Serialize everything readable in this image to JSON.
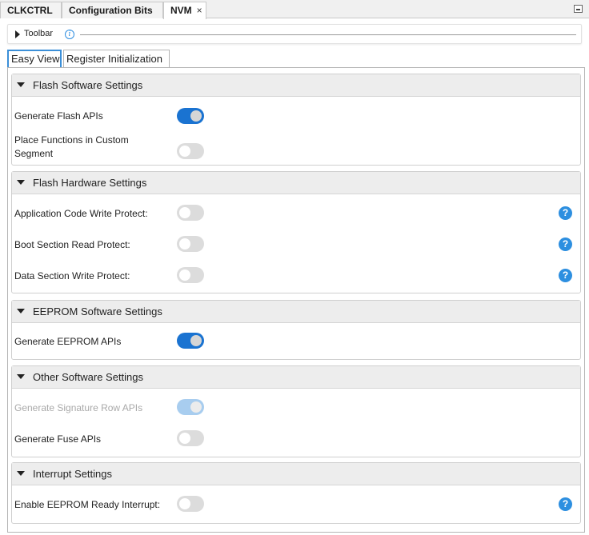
{
  "doc_tabs": [
    {
      "label": "CLKCTRL"
    },
    {
      "label": "Configuration Bits"
    },
    {
      "label": "NVM",
      "close": "×"
    }
  ],
  "toolbar": {
    "label": "Toolbar",
    "info": "i"
  },
  "view_tabs": [
    {
      "label": "Easy View"
    },
    {
      "label": "Register Initialization"
    }
  ],
  "sections": [
    {
      "title": "Flash Software Settings",
      "rows": [
        {
          "label": "Generate Flash APIs",
          "on": true
        },
        {
          "label_line1": "Place Functions in Custom",
          "label_line2": "Segment",
          "on": false
        }
      ]
    },
    {
      "title": "Flash Hardware Settings",
      "rows": [
        {
          "label": "Application Code Write Protect:",
          "on": false,
          "help": "?"
        },
        {
          "label": "Boot Section Read Protect:",
          "on": false,
          "help": "?"
        },
        {
          "label": "Data Section Write Protect:",
          "on": false,
          "help": "?"
        }
      ]
    },
    {
      "title": "EEPROM Software Settings",
      "rows": [
        {
          "label": "Generate EEPROM APIs",
          "on": true
        }
      ]
    },
    {
      "title": "Other Software Settings",
      "rows": [
        {
          "label": "Generate Signature Row APIs",
          "on": true,
          "disabled": true
        },
        {
          "label": "Generate Fuse APIs",
          "on": false
        }
      ]
    },
    {
      "title": "Interrupt Settings",
      "rows": [
        {
          "label": "Enable EEPROM Ready Interrupt:",
          "on": false,
          "help": "?"
        }
      ]
    }
  ]
}
